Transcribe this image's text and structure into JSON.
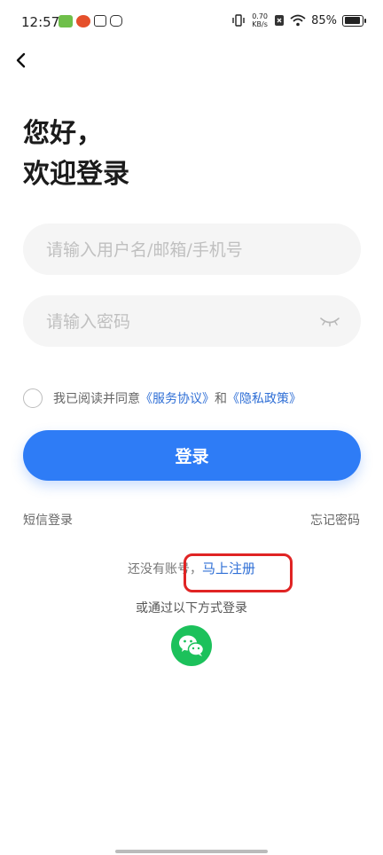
{
  "status_bar": {
    "time": "12:57",
    "net_speed_value": "0.70",
    "net_speed_unit": "KB/s",
    "battery": "85%"
  },
  "greeting": {
    "line1": "您好，",
    "line2": "欢迎登录"
  },
  "form": {
    "username_placeholder": "请输入用户名/邮箱/手机号",
    "password_placeholder": "请输入密码"
  },
  "agreement": {
    "prefix": "我已阅读并同意",
    "service_link": "《服务协议》",
    "and": "和",
    "privacy_link": "《隐私政策》"
  },
  "login_button": "登录",
  "sms_login": "短信登录",
  "forgot_password": "忘记密码",
  "register": {
    "prompt": "还没有账号，",
    "link": "马上注册"
  },
  "other_login": "或通过以下方式登录",
  "colors": {
    "primary": "#2e7cf6",
    "link": "#2f6fd6",
    "wechat": "#1cc15b",
    "highlight": "#e02424"
  }
}
